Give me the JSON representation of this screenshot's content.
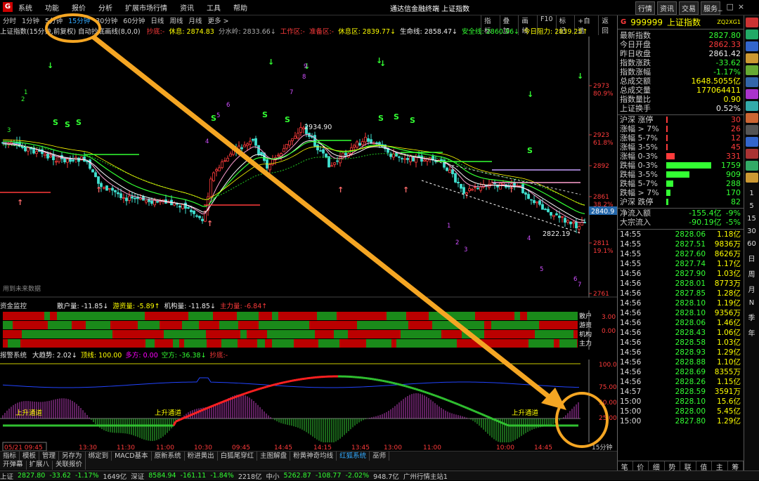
{
  "menu": {
    "items": [
      "系统",
      "功能",
      "报价",
      "分析",
      "扩展市场行情",
      "资讯",
      "工具",
      "帮助"
    ],
    "window_title": "通达信金融终端  上证指数",
    "right_buttons": [
      "行情",
      "资讯",
      "交易",
      "服务"
    ]
  },
  "periods": [
    "分时",
    "1分钟",
    "5分钟",
    "15分钟",
    "30分钟",
    "60分钟",
    "日线",
    "周线",
    "月线",
    "更多 >"
  ],
  "active_period": "15分钟",
  "chart_tools": [
    "指标",
    "叠加",
    "画线",
    "F10",
    "标记",
    "+自选",
    "返回"
  ],
  "infobar": {
    "title": "上证指数(15分钟,前复权) 自动抄底画线(8,0,0)",
    "items": [
      {
        "t": "抄底:-",
        "c": "#ff3b3b"
      },
      {
        "t": "休息: 2874.83",
        "c": "#ff0"
      },
      {
        "t": "分水岭: 2833.66↓",
        "c": "#aaa"
      },
      {
        "t": "工作区:-",
        "c": "#ff3b3b"
      },
      {
        "t": "准备区:-",
        "c": "#ff3b3b"
      },
      {
        "t": "休息区: 2839.77↓",
        "c": "#ff0"
      },
      {
        "t": "生命线: 2858.47↓",
        "c": "#eee"
      },
      {
        "t": "安全线: 2860.96↓",
        "c": "#3f3"
      },
      {
        "t": "今日阻力: 2839.25↑",
        "c": "#ff0"
      }
    ]
  },
  "main_axis": [
    {
      "label": "2973",
      "pct": "80.9%"
    },
    {
      "label": "2923",
      "pct": "61.8%"
    },
    {
      "label": "2892",
      "pct": ""
    },
    {
      "label": "2861",
      "pct": "38.2%"
    },
    {
      "label": "2811",
      "pct": "19.1%"
    },
    {
      "label": "2761",
      "pct": ""
    }
  ],
  "price_marker": "2840.9",
  "annotations": {
    "high": "2934.90",
    "low": "2822.19",
    "future": "用到未来数据"
  },
  "fund": {
    "title": "资金监控",
    "items": [
      {
        "t": "散户量: -11.85↓",
        "c": "#eee"
      },
      {
        "t": "游资量: -5.89↑",
        "c": "#ff0"
      },
      {
        "t": "机构量: -11.85↓",
        "c": "#eee"
      },
      {
        "t": "主力量: -6.84↑",
        "c": "#ff3b3b"
      }
    ],
    "axis": [
      "3.00",
      "0.00"
    ],
    "row_labels": [
      "散户",
      "游资",
      "机构",
      "主力"
    ]
  },
  "warn": {
    "title": "报警系统",
    "items": [
      {
        "t": "大趋势: 2.02↓",
        "c": "#eee"
      },
      {
        "t": "顶线: 100.00",
        "c": "#ff0"
      },
      {
        "t": "多方: 0.00",
        "c": "#f0f"
      },
      {
        "t": "空方: -36.38↓",
        "c": "#3f3"
      },
      {
        "t": "抄底:-",
        "c": "#ff3b3b"
      }
    ],
    "axis": [
      "100.0",
      "75.00",
      "50.00",
      "25.00"
    ],
    "labels": [
      "上升通道",
      "上升通道",
      "上升通道"
    ]
  },
  "time_axis": {
    "first": "05/21 09:45",
    "ticks": [
      "13:30",
      "11:30",
      "11:00",
      "10:30",
      "09:45",
      "14:45",
      "14:15",
      "13:45",
      "13:00",
      "11:00",
      "10:00",
      "14:45"
    ],
    "period": "15分钟"
  },
  "tabs1": [
    "指标",
    "模板",
    "管理",
    "另存为",
    "绑定到",
    "MACD基本",
    "原新系统",
    "粉进黄出",
    "白狐尾穿红",
    "主图解盘",
    "粉黄神奇均线",
    "红狐系统",
    "巫师"
  ],
  "tabs1_active": "红狐系统",
  "tabs2": [
    "开弹幕",
    "扩展八",
    "关联报价"
  ],
  "status": [
    {
      "t": "上证",
      "c": "#ccc"
    },
    {
      "t": "2827.80",
      "c": "#3f3"
    },
    {
      "t": "-33.62",
      "c": "#3f3"
    },
    {
      "t": "-1.17%",
      "c": "#3f3"
    },
    {
      "t": "1649亿",
      "c": "#ccc"
    },
    {
      "t": "深证",
      "c": "#ccc"
    },
    {
      "t": "8584.94",
      "c": "#3f3"
    },
    {
      "t": "-161.11",
      "c": "#3f3"
    },
    {
      "t": "-1.84%",
      "c": "#3f3"
    },
    {
      "t": "2218亿",
      "c": "#ccc"
    },
    {
      "t": "中小",
      "c": "#ccc"
    },
    {
      "t": "5262.87",
      "c": "#3f3"
    },
    {
      "t": "-108.77",
      "c": "#3f3"
    },
    {
      "t": "-2.02%",
      "c": "#3f3"
    },
    {
      "t": "948.7亿",
      "c": "#ccc"
    },
    {
      "t": "广州行情主站1",
      "c": "#ccc"
    }
  ],
  "panel": {
    "code": "999999",
    "name": "上证指数",
    "tag": "ZQ2XG1",
    "quote": [
      {
        "k": "最新指数",
        "v": "2827.80",
        "c": "#3f3"
      },
      {
        "k": "今日开盘",
        "v": "2862.33",
        "c": "#ff3b3b"
      },
      {
        "k": "昨日收盘",
        "v": "2861.42",
        "c": "#eee"
      },
      {
        "k": "指数涨跌",
        "v": "-33.62",
        "c": "#3f3"
      },
      {
        "k": "指数涨幅",
        "v": "-1.17%",
        "c": "#3f3"
      },
      {
        "k": "总成交额",
        "v": "1648.5055亿",
        "c": "#ff0"
      },
      {
        "k": "总成交量",
        "v": "177064411",
        "c": "#ff0"
      },
      {
        "k": "指数量比",
        "v": "0.90",
        "c": "#ff0"
      },
      {
        "k": "上证换手",
        "v": "0.52%",
        "c": "#eee"
      }
    ],
    "dist": [
      {
        "k": "沪深 涨停",
        "v": "30",
        "pct": 0.005,
        "c": "#ff3b3b"
      },
      {
        "k": "涨幅 > 7%",
        "v": "26",
        "pct": 0.005,
        "c": "#ff3b3b"
      },
      {
        "k": "涨幅 5-7%",
        "v": "12",
        "pct": 0.003,
        "c": "#ff3b3b"
      },
      {
        "k": "涨幅 3-5%",
        "v": "45",
        "pct": 0.008,
        "c": "#ff3b3b"
      },
      {
        "k": "涨幅 0-3%",
        "v": "331",
        "pct": 0.19,
        "c": "#ff3b3b"
      },
      {
        "k": "跌幅 0-3%",
        "v": "1759",
        "pct": 1.0,
        "c": "#3f3"
      },
      {
        "k": "跌幅 3-5%",
        "v": "909",
        "pct": 0.52,
        "c": "#3f3"
      },
      {
        "k": "跌幅 5-7%",
        "v": "288",
        "pct": 0.16,
        "c": "#3f3"
      },
      {
        "k": "跌幅 > 7%",
        "v": "170",
        "pct": 0.1,
        "c": "#3f3"
      },
      {
        "k": "沪深 跌停",
        "v": "82",
        "pct": 0.04,
        "c": "#3f3"
      }
    ],
    "flow": [
      {
        "k": "净流入额",
        "v": "-155.4亿",
        "p": "-9%"
      },
      {
        "k": "大宗流入",
        "v": "-90.19亿",
        "p": "-5%"
      }
    ],
    "ticks": [
      {
        "t": "14:55",
        "p": "2828.06",
        "q": "1.18亿"
      },
      {
        "t": "14:55",
        "p": "2827.51",
        "q": "9836万"
      },
      {
        "t": "14:55",
        "p": "2827.60",
        "q": "8626万"
      },
      {
        "t": "14:55",
        "p": "2827.74",
        "q": "1.17亿"
      },
      {
        "t": "14:56",
        "p": "2827.90",
        "q": "1.03亿"
      },
      {
        "t": "14:56",
        "p": "2828.01",
        "q": "8773万"
      },
      {
        "t": "14:56",
        "p": "2827.85",
        "q": "1.28亿"
      },
      {
        "t": "14:56",
        "p": "2828.10",
        "q": "1.19亿"
      },
      {
        "t": "14:56",
        "p": "2828.10",
        "q": "9356万"
      },
      {
        "t": "14:56",
        "p": "2828.06",
        "q": "1.46亿"
      },
      {
        "t": "14:56",
        "p": "2828.43",
        "q": "1.06亿"
      },
      {
        "t": "14:56",
        "p": "2828.58",
        "q": "1.03亿"
      },
      {
        "t": "14:56",
        "p": "2828.93",
        "q": "1.29亿"
      },
      {
        "t": "14:56",
        "p": "2828.88",
        "q": "1.10亿"
      },
      {
        "t": "14:56",
        "p": "2828.69",
        "q": "8355万"
      },
      {
        "t": "14:56",
        "p": "2828.26",
        "q": "1.15亿"
      },
      {
        "t": "14:57",
        "p": "2828.59",
        "q": "3591万"
      },
      {
        "t": "15:00",
        "p": "2828.10",
        "q": "15.6亿"
      },
      {
        "t": "15:00",
        "p": "2828.00",
        "q": "5.45亿"
      },
      {
        "t": "15:00",
        "p": "2827.80",
        "q": "1.29亿"
      }
    ],
    "tabs": [
      "笔",
      "价",
      "细",
      "势",
      "联",
      "值",
      "主",
      "筹"
    ]
  },
  "rightbar": [
    "1",
    "5",
    "15",
    "30",
    "60",
    "日",
    "周",
    "月",
    "N",
    "季",
    "年"
  ],
  "overlay": {
    "color": "#f5a623"
  }
}
